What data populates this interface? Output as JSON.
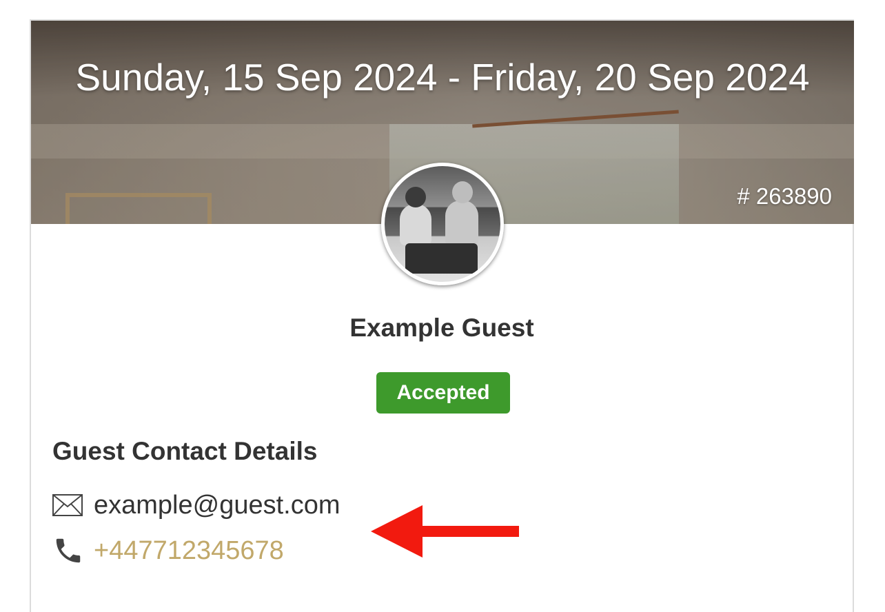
{
  "header": {
    "date_range": "Sunday, 15 Sep 2024 - Friday, 20 Sep 2024",
    "booking_number": "# 263890"
  },
  "guest": {
    "name": "Example Guest",
    "status": "Accepted"
  },
  "contact": {
    "section_title": "Guest Contact Details",
    "email": "example@guest.com",
    "phone": "+447712345678"
  },
  "icons": {
    "email": "envelope-icon",
    "phone": "phone-icon",
    "annotation": "red-arrow"
  },
  "colors": {
    "status_badge": "#3e9a2c",
    "phone_link": "#c1a86a",
    "annotation_arrow": "#f21a0f"
  }
}
